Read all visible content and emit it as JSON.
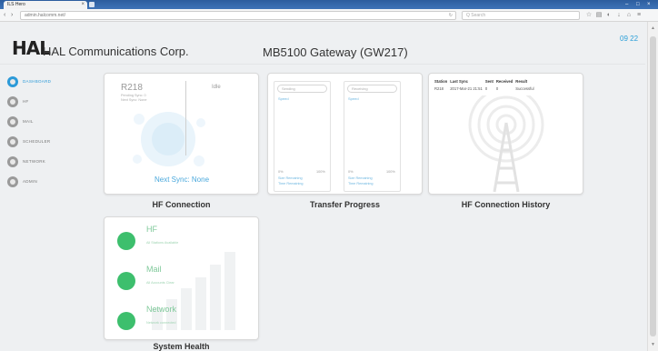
{
  "browser": {
    "tab_title": "ILS Hero",
    "tab_close": "×",
    "url_prefix": "admin.halcomm.net/",
    "url_host": "halcomm",
    "url_suffix": ".net/index",
    "search_placeholder": "Q Search",
    "clock": "09 22"
  },
  "header": {
    "logo": "HAL",
    "company": "HAL Communications Corp.",
    "gateway": "MB5100 Gateway (GW217)"
  },
  "sidebar": {
    "items": [
      {
        "label": "DASHBOARD",
        "active": true
      },
      {
        "label": "HF",
        "active": false
      },
      {
        "label": "MAIL",
        "active": false
      },
      {
        "label": "SCHEDULER",
        "active": false
      },
      {
        "label": "NETWORK",
        "active": false
      },
      {
        "label": "ADMIN",
        "active": false
      }
    ]
  },
  "hf_connection": {
    "title": "HF Connection",
    "station": "R218",
    "status": "Idle",
    "sub1": "Pending Sync: 0",
    "sub2": "Next Sync: None",
    "next_sync": "Next Sync: None"
  },
  "transfer": {
    "title": "Transfer Progress",
    "columns": [
      {
        "label": "Sending",
        "speed": "Speed",
        "pct_left": "0%",
        "pct_right": "100%",
        "rem1": "Size Remaining",
        "rem2": "Time Remaining"
      },
      {
        "label": "Receiving",
        "speed": "Speed",
        "pct_left": "0%",
        "pct_right": "100%",
        "rem1": "Size Remaining",
        "rem2": "Time Remaining"
      }
    ]
  },
  "history": {
    "title": "HF Connection History",
    "headers": [
      "Station",
      "Last Sync",
      "Sent",
      "Received",
      "Result"
    ],
    "rows": [
      [
        "R218",
        "2017-Mar-21 21:51",
        "0",
        "0",
        "Successful"
      ]
    ]
  },
  "health": {
    "title": "System Health",
    "items": [
      {
        "name": "HF",
        "sub": "All Stations Available",
        "color": "#3dbf6d"
      },
      {
        "name": "Mail",
        "sub": "All Accounts Clear",
        "color": "#3dbf6d"
      },
      {
        "name": "Network",
        "sub": "Network connected",
        "color": "#3dbf6d"
      }
    ]
  },
  "colors": {
    "accent": "#2c9ad8",
    "ok": "#3dbf6d"
  }
}
